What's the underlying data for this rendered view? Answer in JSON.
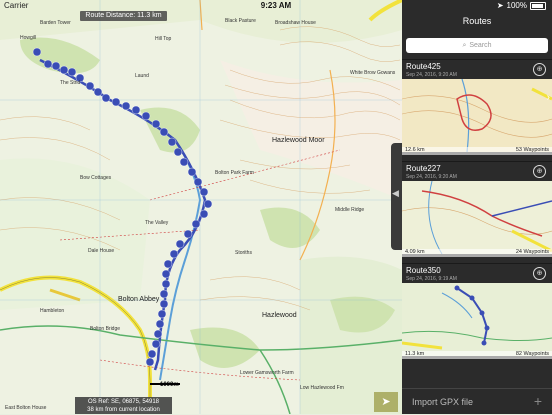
{
  "status_bar": {
    "carrier": "Carrier",
    "time": "9:23 AM",
    "battery": "100%"
  },
  "map": {
    "route_distance": "Route Distance: 11.3 km",
    "scale_label": "1000m",
    "os_ref": "OS Ref: SE, 06875, 54918",
    "from_location": "38 km from current location",
    "places": {
      "hazlewood_moor": "Hazlewood Moor",
      "bolton_abbey": "Bolton Abbey",
      "hazlewood": "Hazlewood",
      "broadshaw_house": "Broadshaw House",
      "black_pasture": "Black Pasture",
      "white_brow_gowans": "White Brow Gowans",
      "bolton_park_farm": "Bolton Park Farm",
      "storiths": "Storiths",
      "hambleton": "Hambleton",
      "bolton_bridge": "Bolton Bridge",
      "dale_house": "Dale House",
      "lower_gamsworth": "Lower Gamsworth Farm",
      "east_bolton_house": "East Bolton House",
      "low_hazlewood": "Low Hazlewood Fm",
      "howgill": "Howgill",
      "bow_cottages": "Bow Cottages",
      "laund": "Laund",
      "hill_top": "Hill Top",
      "barden_tower": "Barden Tower",
      "middle_ridge": "Middle Ridge",
      "the_strid": "The Strid",
      "the_valley": "The Valley"
    }
  },
  "panel": {
    "title": "Routes",
    "search_placeholder": "Search",
    "routes": [
      {
        "name": "Route425",
        "date": "Sep 24, 2016, 9:20 AM",
        "distance": "12.6 km",
        "waypoints": "53 Waypoints"
      },
      {
        "name": "Route227",
        "date": "Sep 24, 2016, 9:20 AM",
        "distance": "4.09 km",
        "waypoints": "24 Waypoints"
      },
      {
        "name": "Route350",
        "date": "Sep 24, 2016, 9:19 AM",
        "distance": "11.3 km",
        "waypoints": "82 Waypoints"
      }
    ],
    "import_label": "Import GPX file"
  },
  "colors": {
    "route_blue": "#3a4db5",
    "panel_bg": "#2b2b2b",
    "road_yellow": "#f2e23c",
    "river_blue": "#5b9fd8"
  }
}
